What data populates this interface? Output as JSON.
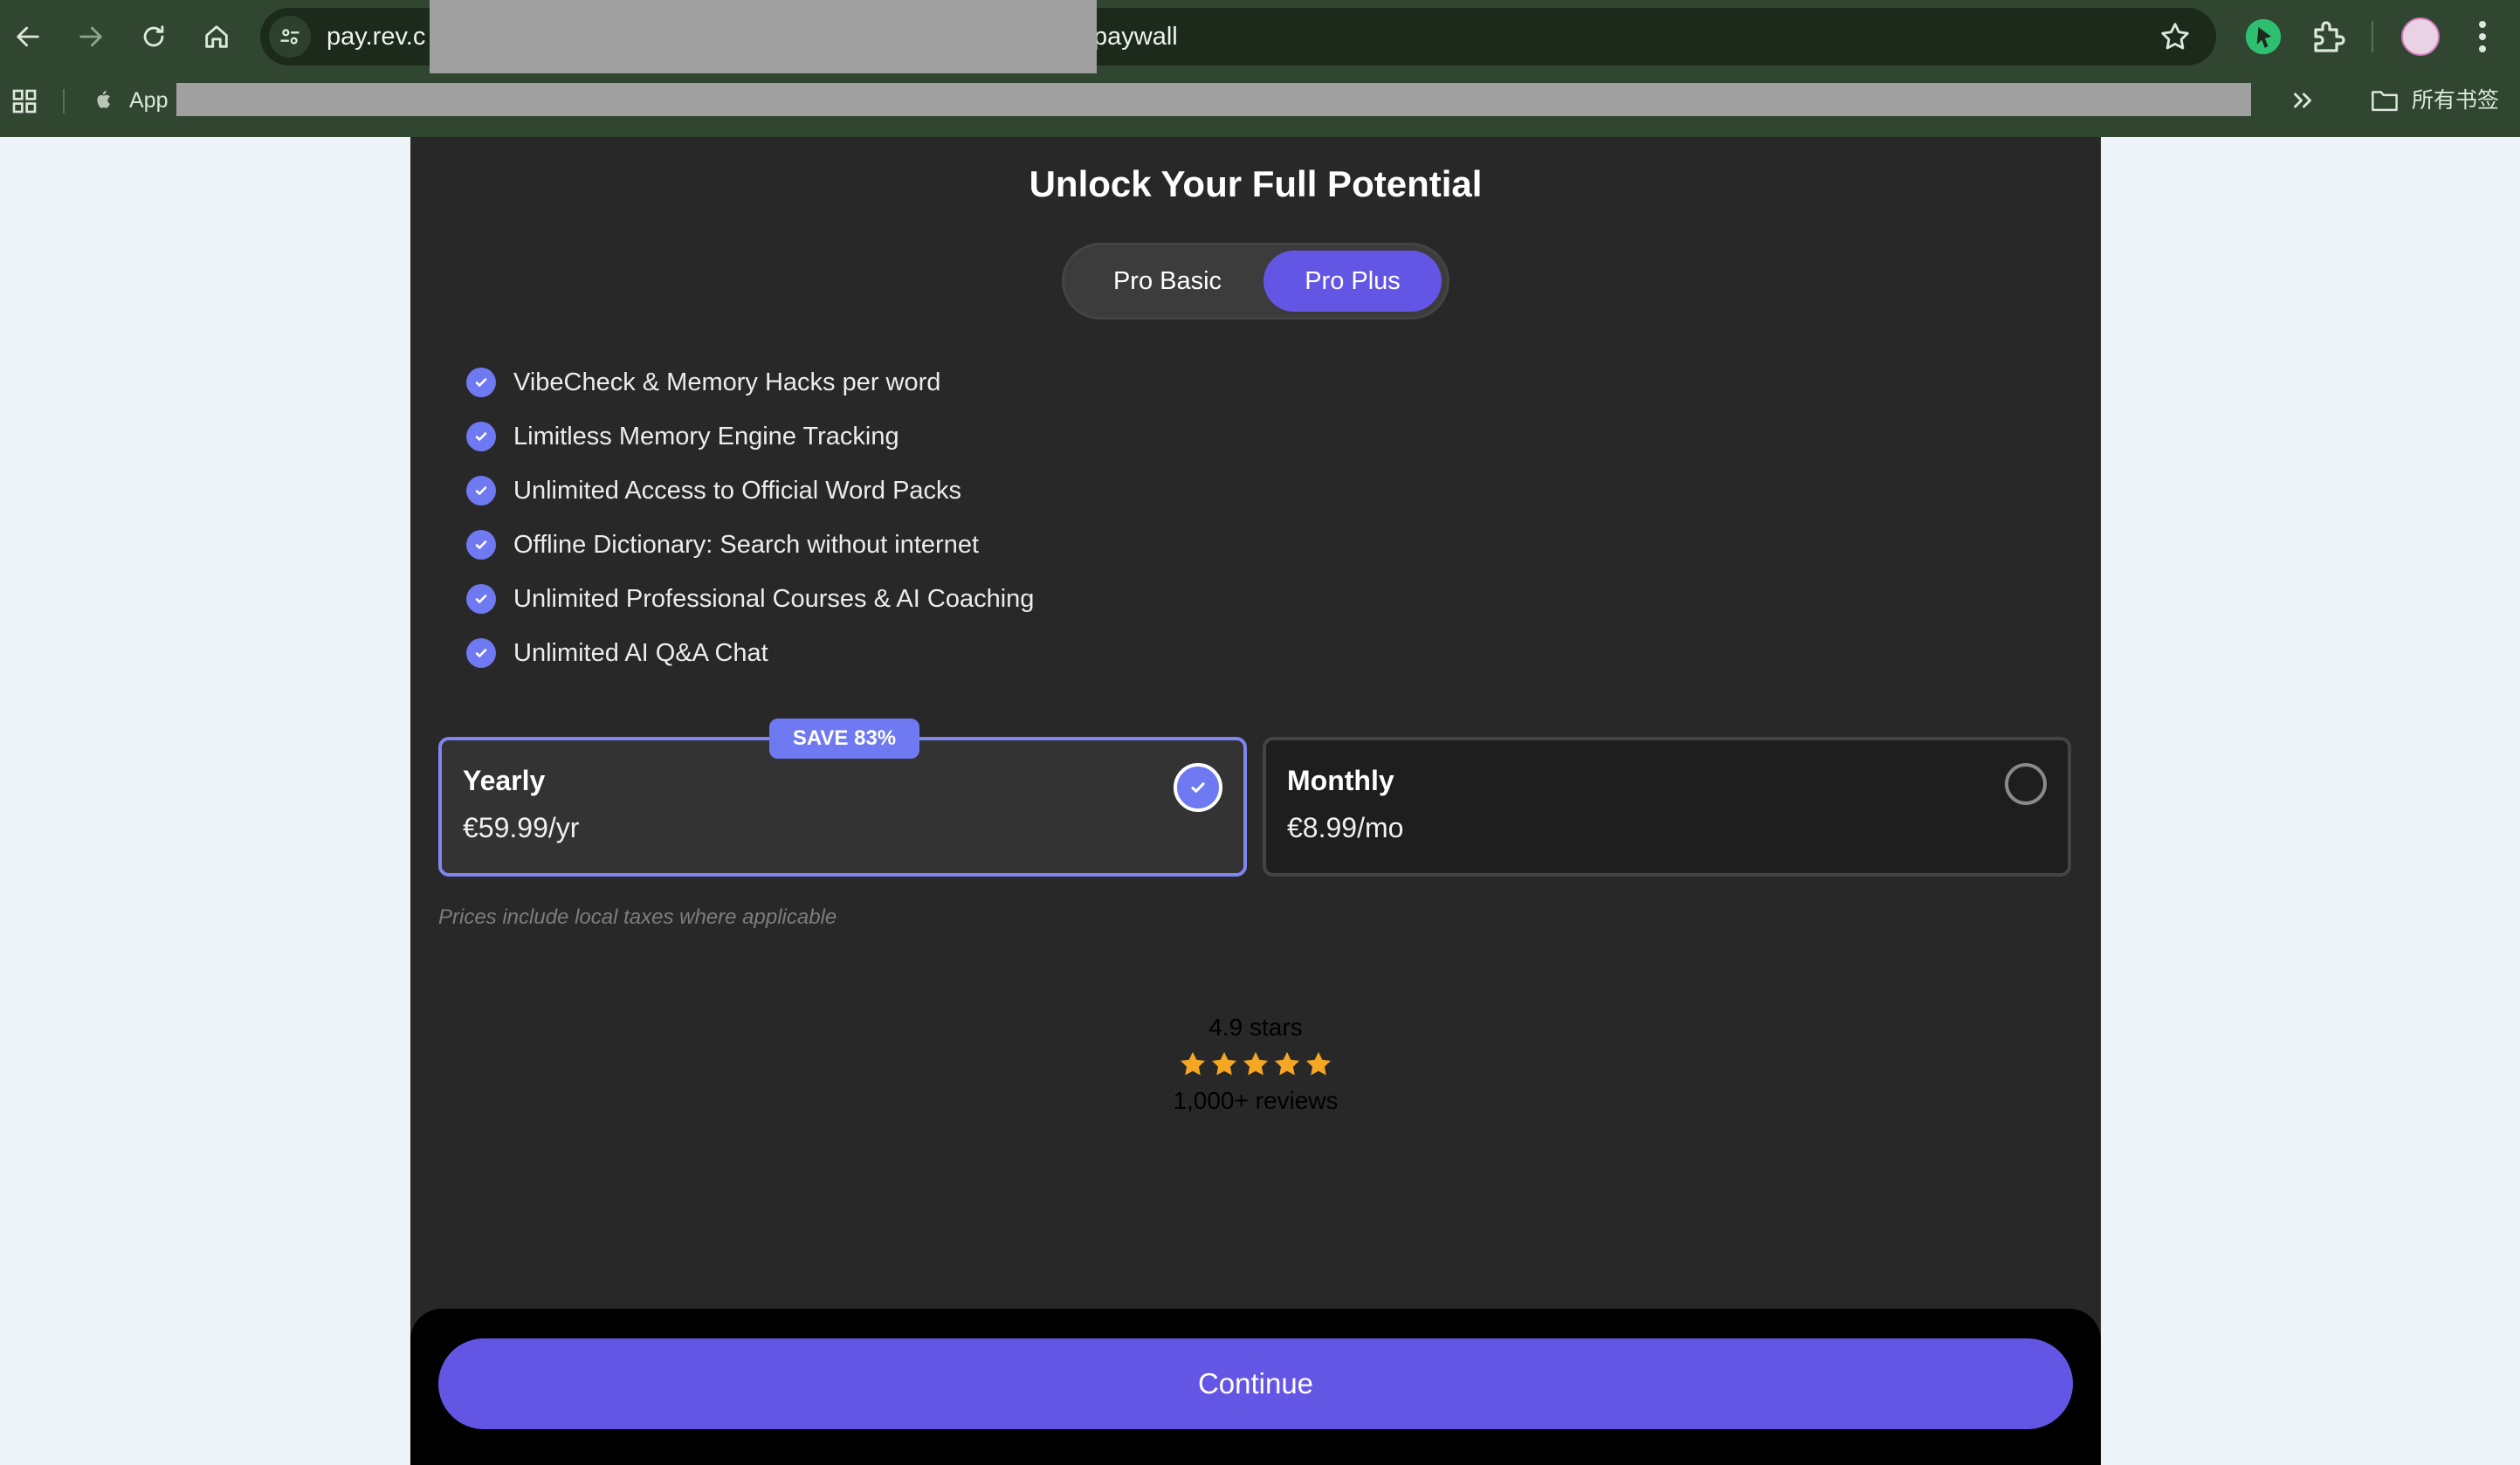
{
  "browser": {
    "url_visible_start": "pay.rev.c",
    "url_visible_end": "paywall",
    "bookmarks": {
      "app_label": "App",
      "all_bookmarks_label": "所有书签"
    }
  },
  "paywall": {
    "title": "Unlock Your Full Potential",
    "tiers": [
      {
        "label": "Pro Basic",
        "selected": false
      },
      {
        "label": "Pro Plus",
        "selected": true
      }
    ],
    "features": [
      "VibeCheck & Memory Hacks per word",
      "Limitless Memory Engine Tracking",
      "Unlimited Access to Official Word Packs",
      "Offline Dictionary: Search without internet",
      "Unlimited Professional Courses & AI Coaching",
      "Unlimited AI Q&A Chat"
    ],
    "plans": [
      {
        "name": "Yearly",
        "price": "€59.99/yr",
        "selected": true,
        "badge": "SAVE 83%"
      },
      {
        "name": "Monthly",
        "price": "€8.99/mo",
        "selected": false
      }
    ],
    "tax_note": "Prices include local taxes where applicable",
    "rating": {
      "score_text": "4.9 stars",
      "stars": 5,
      "reviews_text": "1,000+ reviews"
    },
    "continue_label": "Continue"
  },
  "colors": {
    "accent": "#6456e4",
    "check": "#6e79f2",
    "star": "#f5a623",
    "chrome": "#304630",
    "panel": "#282828"
  }
}
